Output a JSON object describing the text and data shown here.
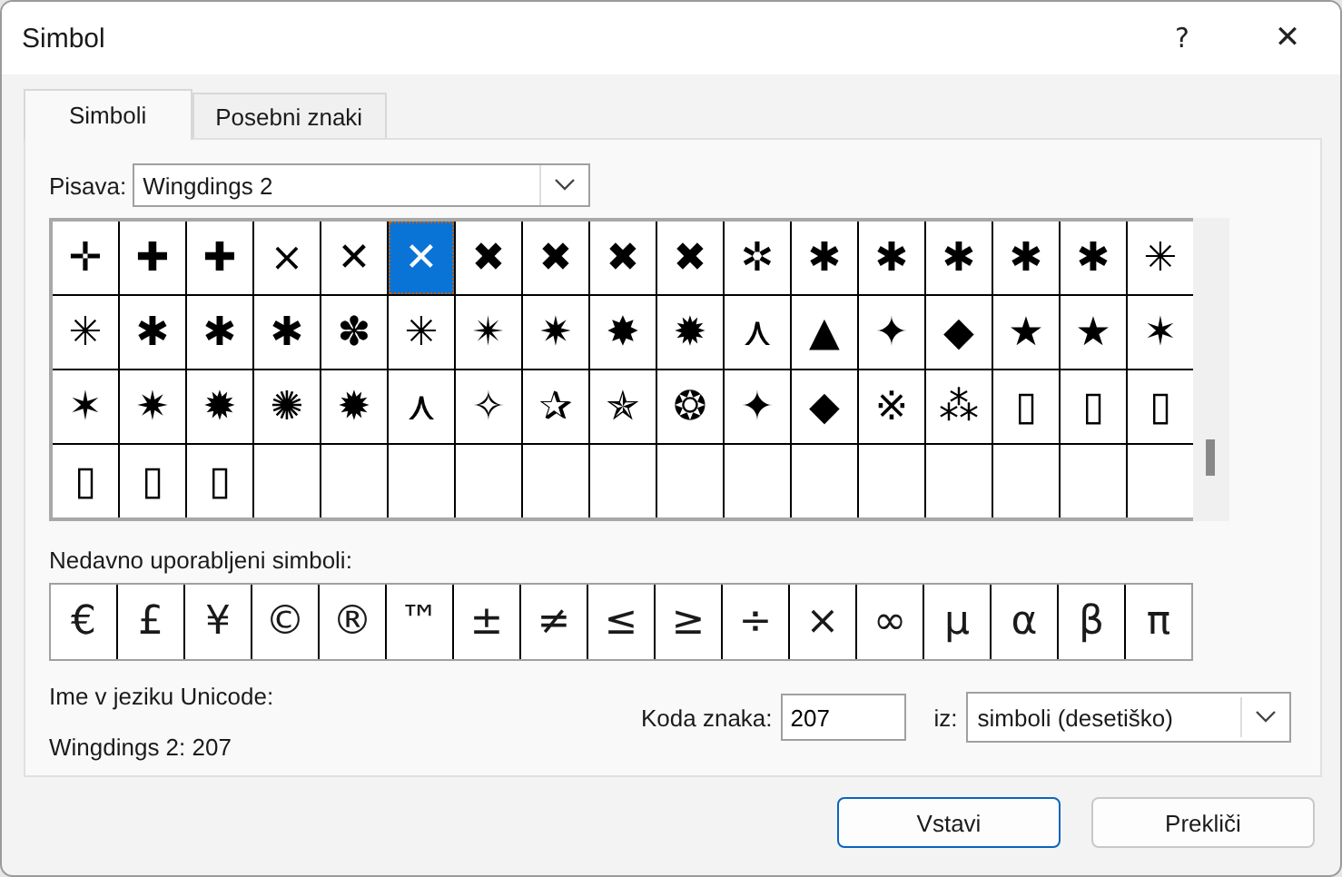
{
  "window": {
    "title": "Simbol",
    "help": "?",
    "close": "✕"
  },
  "tabs": [
    {
      "label": "Simboli",
      "selected": true
    },
    {
      "label": "Posebni znaki",
      "selected": false
    }
  ],
  "font": {
    "label": "Pisava:",
    "value": "Wingdings 2"
  },
  "grid": [
    {
      "symbol": "✛",
      "selected": false
    },
    {
      "symbol": "✚",
      "selected": false
    },
    {
      "symbol": "✚",
      "selected": false
    },
    {
      "symbol": "×",
      "selected": false
    },
    {
      "symbol": "✕",
      "selected": false
    },
    {
      "symbol": "✕",
      "selected": true
    },
    {
      "symbol": "✖",
      "selected": false
    },
    {
      "symbol": "✖",
      "selected": false
    },
    {
      "symbol": "✖",
      "selected": false
    },
    {
      "symbol": "✖",
      "selected": false
    },
    {
      "symbol": "✲",
      "selected": false
    },
    {
      "symbol": "✱",
      "selected": false
    },
    {
      "symbol": "✱",
      "selected": false
    },
    {
      "symbol": "✱",
      "selected": false
    },
    {
      "symbol": "✱",
      "selected": false
    },
    {
      "symbol": "✱",
      "selected": false
    },
    {
      "symbol": "✳",
      "selected": false
    },
    {
      "symbol": "✳",
      "selected": false
    },
    {
      "symbol": "✱",
      "selected": false
    },
    {
      "symbol": "✱",
      "selected": false
    },
    {
      "symbol": "✱",
      "selected": false
    },
    {
      "symbol": "✽",
      "selected": false
    },
    {
      "symbol": "✳",
      "selected": false
    },
    {
      "symbol": "✴",
      "selected": false
    },
    {
      "symbol": "✷",
      "selected": false
    },
    {
      "symbol": "✸",
      "selected": false
    },
    {
      "symbol": "✹",
      "selected": false
    },
    {
      "symbol": "⋏",
      "selected": false
    },
    {
      "symbol": "▲",
      "selected": false
    },
    {
      "symbol": "✦",
      "selected": false
    },
    {
      "symbol": "◆",
      "selected": false
    },
    {
      "symbol": "★",
      "selected": false
    },
    {
      "symbol": "★",
      "selected": false
    },
    {
      "symbol": "✶",
      "selected": false
    },
    {
      "symbol": "✶",
      "selected": false
    },
    {
      "symbol": "✷",
      "selected": false
    },
    {
      "symbol": "✹",
      "selected": false
    },
    {
      "symbol": "✺",
      "selected": false
    },
    {
      "symbol": "✹",
      "selected": false
    },
    {
      "symbol": "⋏",
      "selected": false
    },
    {
      "symbol": "✧",
      "selected": false
    },
    {
      "symbol": "✰",
      "selected": false
    },
    {
      "symbol": "✯",
      "selected": false
    },
    {
      "symbol": "❂",
      "selected": false
    },
    {
      "symbol": "✦",
      "selected": false
    },
    {
      "symbol": "◆",
      "selected": false
    },
    {
      "symbol": "※",
      "selected": false
    },
    {
      "symbol": "⁂",
      "selected": false
    },
    {
      "symbol": "▯",
      "selected": false
    },
    {
      "symbol": "▯",
      "selected": false
    },
    {
      "symbol": "▯",
      "selected": false
    },
    {
      "symbol": "▯",
      "selected": false
    },
    {
      "symbol": "▯",
      "selected": false
    },
    {
      "symbol": "▯",
      "selected": false
    }
  ],
  "recent": {
    "label": "Nedavno uporabljeni simboli:",
    "symbols": [
      "€",
      "£",
      "¥",
      "©",
      "®",
      "™",
      "±",
      "≠",
      "≤",
      "≥",
      "÷",
      "×",
      "∞",
      "µ",
      "α",
      "β",
      "π"
    ]
  },
  "unicode_name": {
    "label": "Ime v jeziku Unicode:",
    "value": "Wingdings 2: 207"
  },
  "char_code": {
    "label": "Koda znaka:",
    "value": "207"
  },
  "from": {
    "label": "iz:",
    "value": "simboli (desetiško)"
  },
  "buttons": [
    {
      "label": "Vstavi",
      "default": true
    },
    {
      "label": "Prekliči",
      "default": false
    }
  ]
}
